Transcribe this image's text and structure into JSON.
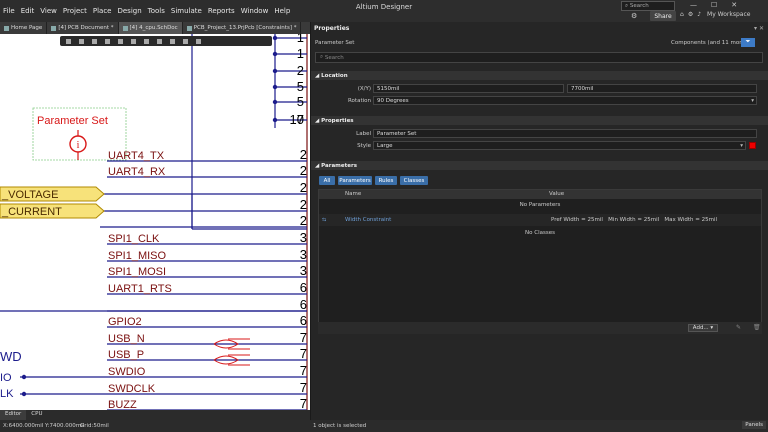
{
  "app": {
    "title": "Altium Designer",
    "menu": [
      "File",
      "Edit",
      "View",
      "Project",
      "Place",
      "Design",
      "Tools",
      "Simulate",
      "Reports",
      "Window",
      "Help"
    ],
    "search_placeholder": "Search",
    "share_label": "Share",
    "workspace_label": "My Workspace"
  },
  "tabs": [
    {
      "label": "Home Page",
      "active": false
    },
    {
      "label": "[4] PCB Document *",
      "active": false
    },
    {
      "label": "[4] 4_cpu.SchDoc",
      "active": true
    },
    {
      "label": "PCB_Project_13.PrjPcb [Constraints] *",
      "active": false
    }
  ],
  "schematic": {
    "pin_numbers_top": [
      "1",
      "1",
      "2",
      "5",
      "5",
      "7",
      "10"
    ],
    "param_set_label": "Parameter Set",
    "param_set_marker": "i",
    "ports": [
      "_VOLTAGE",
      "_CURRENT"
    ],
    "nets": [
      {
        "label": "UART4_TX",
        "pin": "2"
      },
      {
        "label": "UART4_RX",
        "pin": "2"
      },
      {
        "label": "",
        "pin": "2"
      },
      {
        "label": "",
        "pin": "2"
      },
      {
        "label": "",
        "pin": "2"
      },
      {
        "label": "SPI1_CLK",
        "pin": "3"
      },
      {
        "label": "SPI1_MISO",
        "pin": "3"
      },
      {
        "label": "SPI1_MOSI",
        "pin": "3"
      },
      {
        "label": "UART1_RTS",
        "pin": "6"
      },
      {
        "label": "",
        "pin": "6"
      },
      {
        "label": "GPIO2",
        "pin": "6"
      },
      {
        "label": "USB_N",
        "pin": "7"
      },
      {
        "label": "USB_P",
        "pin": "7"
      },
      {
        "label": "SWDIO",
        "pin": "7"
      },
      {
        "label": "SWDCLK",
        "pin": "7"
      },
      {
        "label": "BUZZ",
        "pin": "7"
      }
    ],
    "left_labels": [
      "WD",
      "IO",
      "LK"
    ]
  },
  "bottom_tabs": [
    "Editor",
    "CPU"
  ],
  "status": {
    "coords": "X:6400.000mil Y:7400.000mil",
    "grid": "Grid:50mil",
    "selection": "1 object is selected",
    "panels_label": "Panels"
  },
  "properties": {
    "title": "Properties",
    "subtitle": "Parameter Set",
    "components_filter": "Components (and 11 more)",
    "search_placeholder": "Search",
    "location": {
      "header": "Location",
      "xy_label": "(X/Y)",
      "x": "5150mil",
      "y": "7700mil",
      "rotation_label": "Rotation",
      "rotation": "90 Degrees"
    },
    "props_section": {
      "header": "Properties",
      "label_label": "Label",
      "label_value": "Parameter Set",
      "style_label": "Style",
      "style_value": "Large",
      "style_color": "#e00000"
    },
    "parameters": {
      "header": "Parameters",
      "filters": [
        "All",
        "Parameters",
        "Rules",
        "Classes"
      ],
      "columns": [
        "Name",
        "Value"
      ],
      "no_params": "No Parameters",
      "rule_name": "Width Constraint",
      "rule_value": "Pref Width = 25mil   Min Width = 25mil   Max Width = 25mil",
      "no_classes": "No Classes",
      "add_label": "Add..."
    }
  },
  "colors": {
    "wire": "#1c1c8c",
    "net_text": "#7a1010",
    "port_fill": "#f7e27a",
    "accent": "#3d7bc7"
  }
}
